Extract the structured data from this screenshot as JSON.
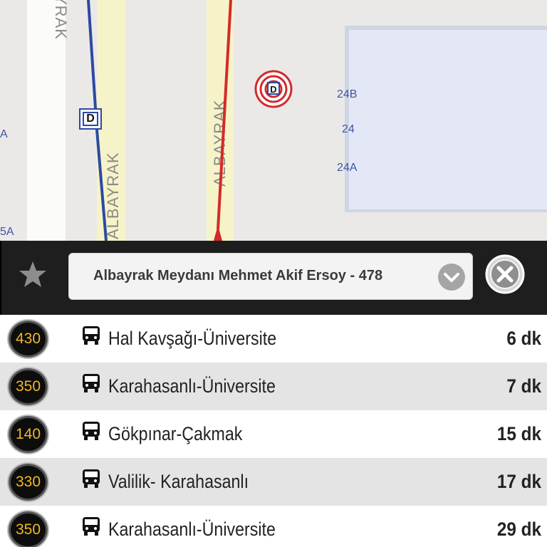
{
  "map": {
    "street_labels": [
      "YRAK",
      "ALBAYRAK",
      "ALBAYRAK"
    ],
    "address_labels": [
      "24B",
      "24",
      "24A",
      "A",
      "5A"
    ],
    "stop_marker_label": "D",
    "target_label": "D",
    "route_colors": {
      "blue": "#2c4aa0",
      "red": "#d42a2a"
    }
  },
  "stop_bar": {
    "favorite_icon": "star-icon",
    "selected_stop": "Albayrak Meydanı Mehmet Akif Ersoy - 478",
    "dropdown_icon": "chevron-down-icon",
    "close_icon": "close-icon"
  },
  "arrivals": [
    {
      "line": "430",
      "route": "Hal Kavşağı-Üniversite",
      "eta": "6 dk"
    },
    {
      "line": "350",
      "route": "Karahasanlı-Üniversite",
      "eta": "7 dk"
    },
    {
      "line": "140",
      "route": "Gökpınar-Çakmak",
      "eta": "15 dk"
    },
    {
      "line": "330",
      "route": "Valilik- Karahasanlı",
      "eta": "17 dk"
    },
    {
      "line": "350",
      "route": "Karahasanlı-Üniversite",
      "eta": "29 dk"
    }
  ],
  "colors": {
    "badge_text": "#f0b820",
    "bar_bg": "#1e1e1e"
  }
}
